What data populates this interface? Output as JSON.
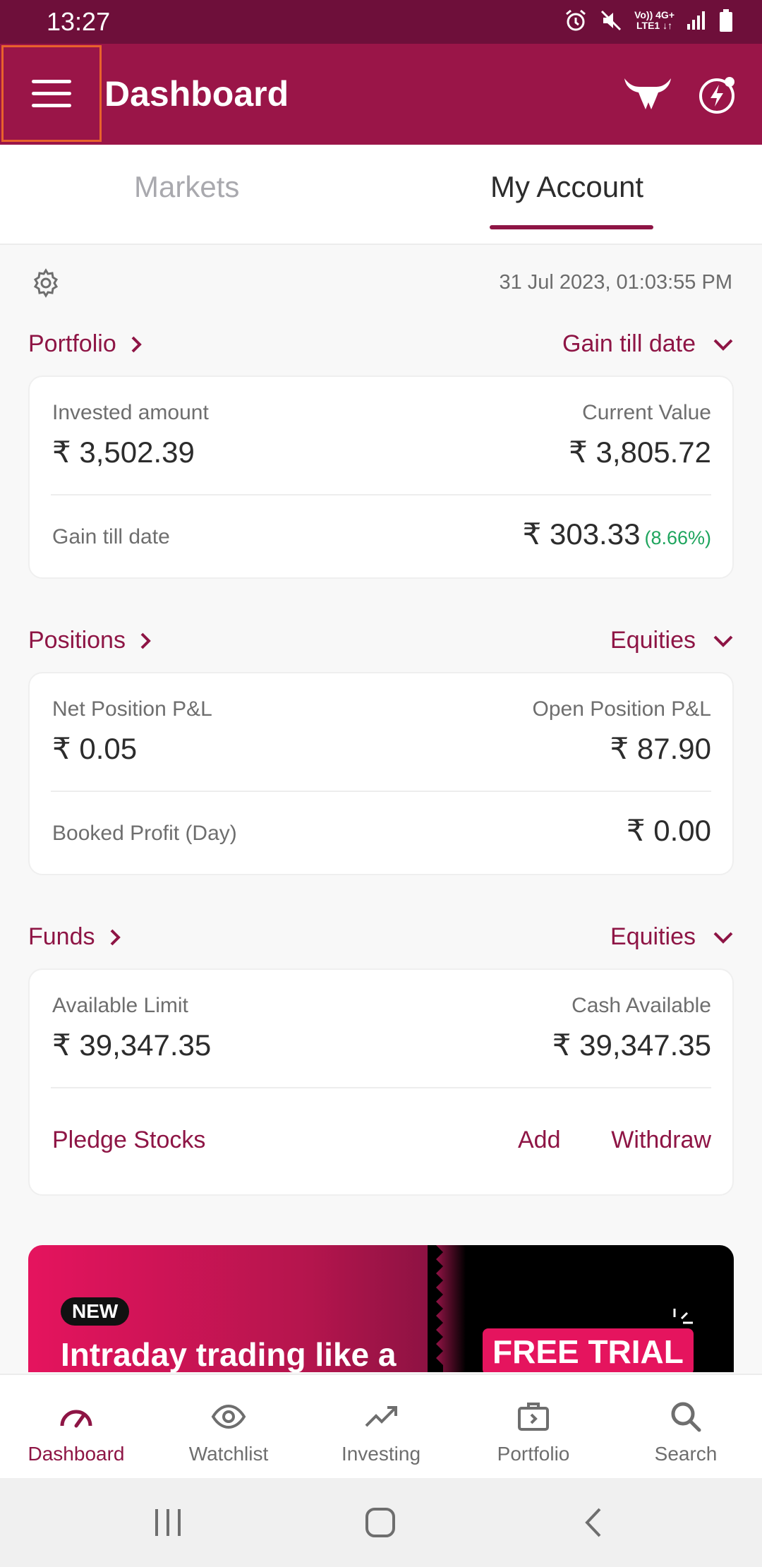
{
  "status_bar": {
    "time": "13:27",
    "network_top": "Vo)) 4G+",
    "network_bottom": "LTE1 ↓↑"
  },
  "app_bar": {
    "title": "Dashboard"
  },
  "tabs": [
    {
      "label": "Markets",
      "active": false
    },
    {
      "label": "My Account",
      "active": true
    }
  ],
  "timestamp": "31 Jul 2023, 01:03:55 PM",
  "portfolio": {
    "title": "Portfolio",
    "filter": "Gain till date",
    "invested_label": "Invested amount",
    "invested_value": "₹ 3,502.39",
    "current_label": "Current Value",
    "current_value": "₹ 3,805.72",
    "gain_label": "Gain till date",
    "gain_value": "₹ 303.33",
    "gain_pct": "(8.66%)"
  },
  "positions": {
    "title": "Positions",
    "filter": "Equities",
    "net_label": "Net Position P&L",
    "net_value": "₹ 0.05",
    "open_label": "Open Position P&L",
    "open_value": "₹ 87.90",
    "booked_label": "Booked Profit (Day)",
    "booked_value": "₹ 0.00"
  },
  "funds": {
    "title": "Funds",
    "filter": "Equities",
    "available_label": "Available Limit",
    "available_value": "₹ 39,347.35",
    "cash_label": "Cash Available",
    "cash_value": "₹ 39,347.35",
    "pledge_label": "Pledge Stocks",
    "add_label": "Add",
    "withdraw_label": "Withdraw"
  },
  "banner": {
    "badge": "NEW",
    "text": "Intraday trading like a",
    "cta": "FREE TRIAL"
  },
  "bottom_nav": [
    {
      "label": "Dashboard",
      "icon": "speedometer-icon",
      "active": true
    },
    {
      "label": "Watchlist",
      "icon": "eye-icon",
      "active": false
    },
    {
      "label": "Investing",
      "icon": "trend-up-icon",
      "active": false
    },
    {
      "label": "Portfolio",
      "icon": "briefcase-icon",
      "active": false
    },
    {
      "label": "Search",
      "icon": "search-icon",
      "active": false
    }
  ],
  "colors": {
    "brand": "#9a1548",
    "brand_dark": "#6e0f3a",
    "accent_text": "#8e1545",
    "gain": "#1fa55e"
  }
}
